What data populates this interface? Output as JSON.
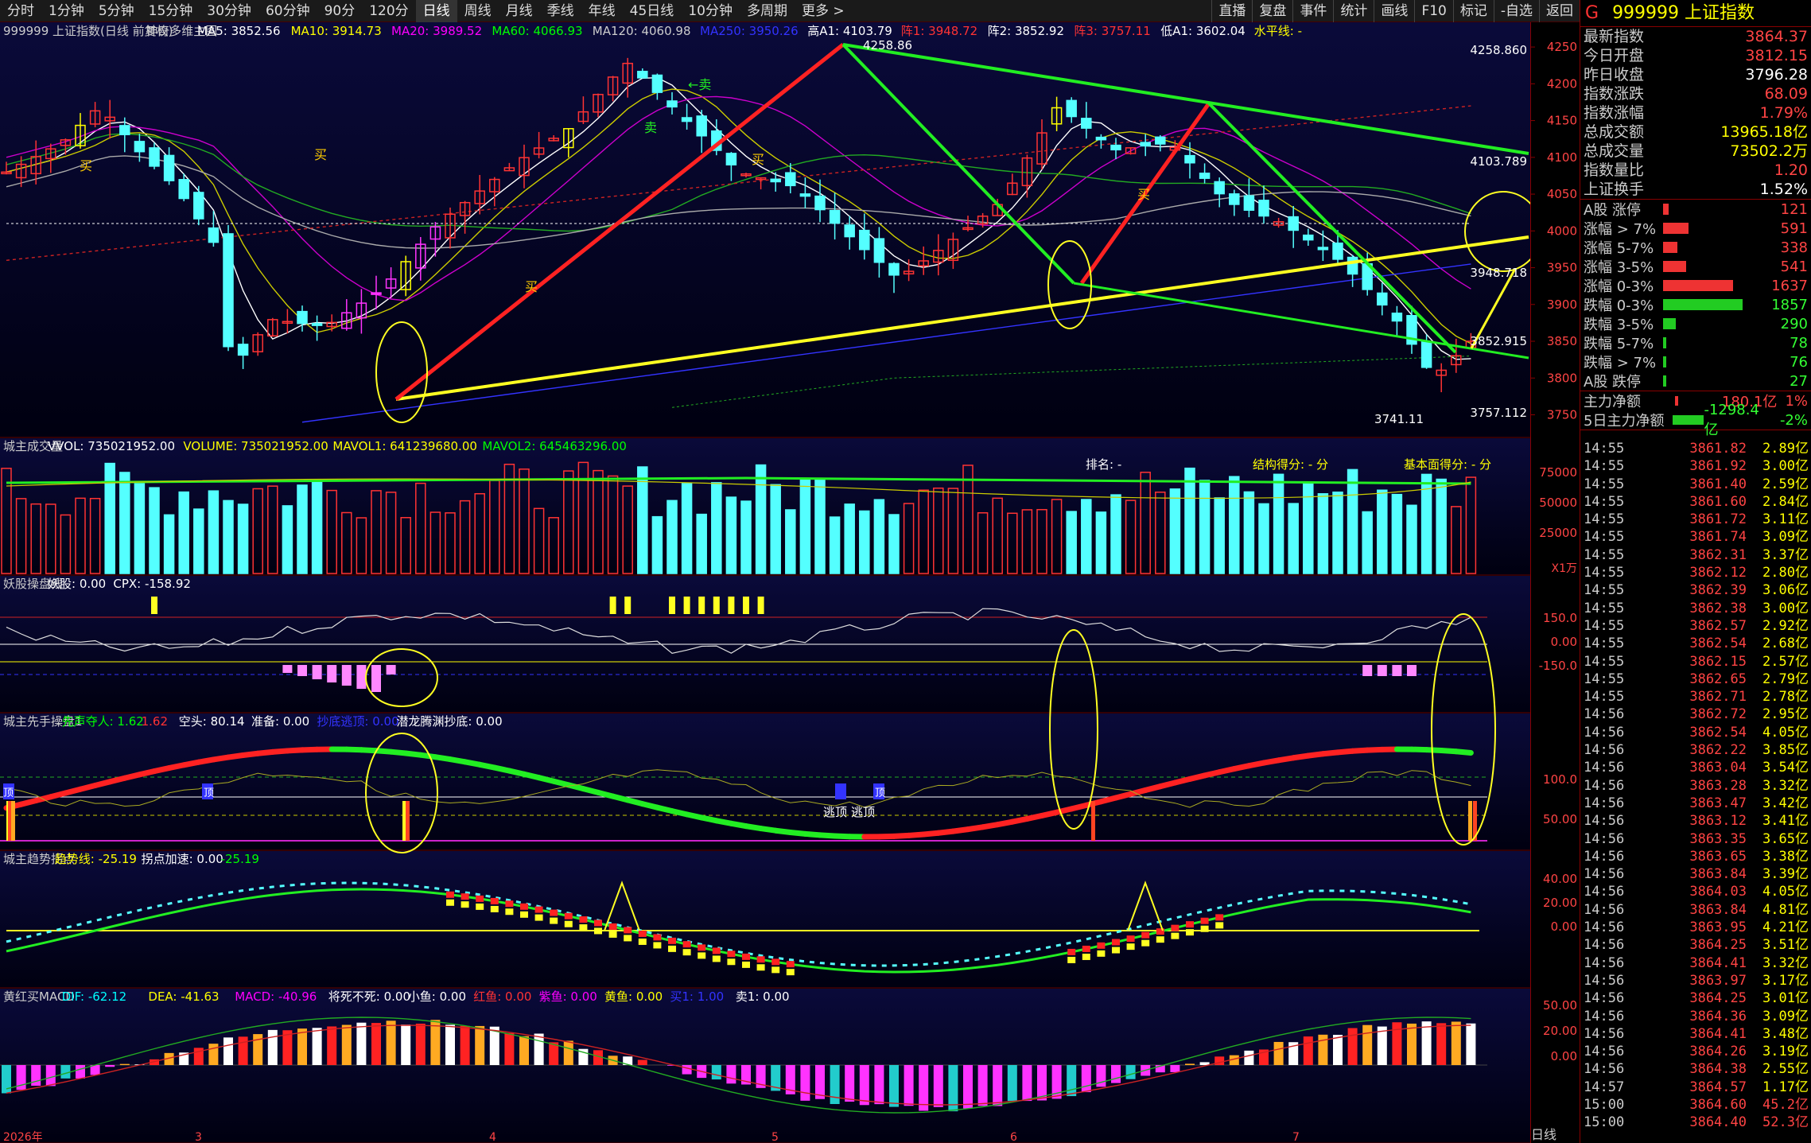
{
  "toolbar": {
    "timeframes": [
      "分时",
      "1分钟",
      "5分钟",
      "15分钟",
      "30分钟",
      "60分钟",
      "90分",
      "120分",
      "日线",
      "周线",
      "月线",
      "季线",
      "年线",
      "45日线",
      "10分钟",
      "多周期",
      "更多 >"
    ],
    "active": "日线",
    "right": [
      "直播",
      "复盘",
      "事件",
      "统计",
      "画线",
      "F10",
      "标记",
      "-自选",
      "返回"
    ]
  },
  "main": {
    "legend": [
      {
        "text": "999999 上证指数(日线 前复权)",
        "color": "#cccccc"
      },
      {
        "text": "神奇多维主图",
        "color": "#cccccc"
      },
      {
        "text": "MA5: 3852.56",
        "color": "#ffffff"
      },
      {
        "text": "MA10: 3914.73",
        "color": "#ffff00"
      },
      {
        "text": "MA20: 3989.52",
        "color": "#ff00ff"
      },
      {
        "text": "MA60: 4066.93",
        "color": "#00ff00"
      },
      {
        "text": "MA120: 4060.98",
        "color": "#cccccc"
      },
      {
        "text": "MA250: 3950.26",
        "color": "#3333ff"
      },
      {
        "text": "高A1: 4103.79",
        "color": "#ffffff"
      },
      {
        "text": "阵1: 3948.72",
        "color": "#ff3333"
      },
      {
        "text": "阵2: 3852.92",
        "color": "#ffffff"
      },
      {
        "text": "阵3: 3757.11",
        "color": "#ff3333"
      },
      {
        "text": "低A1: 3602.04",
        "color": "#ffffff"
      },
      {
        "text": "水平线: -",
        "color": "#ffff00"
      }
    ],
    "y_ticks": [
      "4250",
      "4200",
      "4150",
      "4100",
      "4050",
      "4000",
      "3950",
      "3900",
      "3850",
      "3800",
      "3750"
    ],
    "annotations": {
      "high": "4258.86",
      "r1": "4258.860",
      "r2": "4103.789",
      "r3": "3948.718",
      "r4": "3852.915",
      "r5": "3757.112",
      "low": "3741.11"
    },
    "signals": {
      "buy": "买",
      "sell": "卖",
      "arrow_sell": "←卖"
    }
  },
  "volume": {
    "legend": [
      {
        "text": "城主成交量",
        "color": "#cccccc"
      },
      {
        "text": "VVOL: 735021952.00",
        "color": "#ffffff"
      },
      {
        "text": "VOLUME: 735021952.00",
        "color": "#ffff00"
      },
      {
        "text": "MAVOL1: 641239680.00",
        "color": "#ffff00"
      },
      {
        "text": "MAVOL2: 645463296.00",
        "color": "#00ff00"
      }
    ],
    "rank": "排名: -",
    "struct": "结构得分: - 分",
    "fund": "基本面得分: - 分",
    "y_ticks": [
      "75000",
      "50000",
      "25000"
    ],
    "unit": "X1万"
  },
  "yao": {
    "legend": [
      {
        "text": "妖股操盘线",
        "color": "#cccccc"
      },
      {
        "text": "妖股: 0.00",
        "color": "#ffffff"
      },
      {
        "text": "CPX: -158.92",
        "color": "#ffffff"
      }
    ],
    "y_ticks": [
      "150.0",
      "0.00",
      "-150.0"
    ]
  },
  "xianshou": {
    "legend": [
      {
        "text": "城主先手操盘1",
        "color": "#cccccc"
      },
      {
        "text": "先声夺人: 1.62",
        "color": "#00ff00"
      },
      {
        "text": "1.62",
        "color": "#ff3333"
      },
      {
        "text": "空头: 80.14",
        "color": "#ffffff"
      },
      {
        "text": "准备: 0.00",
        "color": "#ffffff"
      },
      {
        "text": "抄底逃顶: 0.00",
        "color": "#3333ff"
      },
      {
        "text": "潜龙腾渊抄底: 0.00",
        "color": "#ffffff"
      }
    ],
    "y_ticks": [
      "100.0",
      "50.00"
    ],
    "labels": {
      "top": "顶",
      "escape": "逃顶"
    }
  },
  "trend": {
    "legend": [
      {
        "text": "城主趋势拐点",
        "color": "#cccccc"
      },
      {
        "text": "趋势线: -25.19",
        "color": "#ffff00"
      },
      {
        "text": "拐点加速: 0.00",
        "color": "#ffffff"
      },
      {
        "text": "-25.19",
        "color": "#00ff00"
      }
    ],
    "y_ticks": [
      "40.00",
      "20.00",
      "0.00"
    ]
  },
  "macd": {
    "legend": [
      {
        "text": "黄红买MACD",
        "color": "#cccccc"
      },
      {
        "text": "DIF: -62.12",
        "color": "#00ffff"
      },
      {
        "text": "DEA: -41.63",
        "color": "#ffff00"
      },
      {
        "text": "MACD: -40.96",
        "color": "#ff00ff"
      },
      {
        "text": "将死不死: 0.00",
        "color": "#ffffff"
      },
      {
        "text": "小鱼: 0.00",
        "color": "#ffffff"
      },
      {
        "text": "红鱼: 0.00",
        "color": "#ff3333"
      },
      {
        "text": "紫鱼: 0.00",
        "color": "#ff00ff"
      },
      {
        "text": "黄鱼: 0.00",
        "color": "#ffff00"
      },
      {
        "text": "买1: 1.00",
        "color": "#3333ff"
      },
      {
        "text": "卖1: 0.00",
        "color": "#ffffff"
      }
    ],
    "y_ticks": [
      "50.00",
      "20.00",
      "0.00"
    ]
  },
  "x_labels": [
    "2026年",
    "3",
    "4",
    "5",
    "6",
    "7"
  ],
  "side": {
    "code": "999999",
    "name": "上证指数",
    "badge": "G",
    "quote": [
      {
        "k": "最新指数",
        "v": "3864.37",
        "c": "r"
      },
      {
        "k": "今日开盘",
        "v": "3812.15",
        "c": "r"
      },
      {
        "k": "昨日收盘",
        "v": "3796.28",
        "c": "w"
      },
      {
        "k": "指数涨跌",
        "v": "68.09",
        "c": "r"
      },
      {
        "k": "指数涨幅",
        "v": "1.79%",
        "c": "r"
      },
      {
        "k": "总成交额",
        "v": "13965.18亿",
        "c": "y"
      },
      {
        "k": "总成交量",
        "v": "73502.2万",
        "c": "y"
      },
      {
        "k": "指数量比",
        "v": "1.20",
        "c": "r"
      },
      {
        "k": "上证换手",
        "v": "1.52%",
        "c": "w"
      }
    ],
    "breadth": [
      {
        "k": "A股 涨停",
        "n": 121,
        "c": "#ee3333"
      },
      {
        "k": "涨幅 > 7%",
        "n": 591,
        "c": "#ee3333"
      },
      {
        "k": "涨幅 5-7%",
        "n": 338,
        "c": "#ee3333"
      },
      {
        "k": "涨幅 3-5%",
        "n": 541,
        "c": "#ee3333"
      },
      {
        "k": "涨幅 0-3%",
        "n": 1637,
        "c": "#ee3333"
      },
      {
        "k": "跌幅 0-3%",
        "n": 1857,
        "c": "#22cc22"
      },
      {
        "k": "跌幅 3-5%",
        "n": 290,
        "c": "#22cc22"
      },
      {
        "k": "跌幅 5-7%",
        "n": 78,
        "c": "#22cc22"
      },
      {
        "k": "跌幅 > 7%",
        "n": 76,
        "c": "#22cc22"
      },
      {
        "k": "A股 跌停",
        "n": 27,
        "c": "#22cc22"
      }
    ],
    "flow": [
      {
        "k": "主力净额",
        "v": "180.1亿",
        "p": "1%"
      },
      {
        "k": "5日主力净额",
        "v": "-1298.4亿",
        "p": "-2%"
      }
    ],
    "ticks": [
      [
        "14:55",
        "3861.82",
        "2.89亿"
      ],
      [
        "14:55",
        "3861.92",
        "3.00亿"
      ],
      [
        "14:55",
        "3861.40",
        "2.59亿"
      ],
      [
        "14:55",
        "3861.60",
        "2.84亿"
      ],
      [
        "14:55",
        "3861.72",
        "3.11亿"
      ],
      [
        "14:55",
        "3861.74",
        "3.09亿"
      ],
      [
        "14:55",
        "3862.31",
        "3.37亿"
      ],
      [
        "14:55",
        "3862.12",
        "2.80亿"
      ],
      [
        "14:55",
        "3862.39",
        "3.06亿"
      ],
      [
        "14:55",
        "3862.38",
        "3.00亿"
      ],
      [
        "14:55",
        "3862.57",
        "2.92亿"
      ],
      [
        "14:55",
        "3862.54",
        "2.68亿"
      ],
      [
        "14:55",
        "3862.15",
        "2.57亿"
      ],
      [
        "14:55",
        "3862.65",
        "2.79亿"
      ],
      [
        "14:55",
        "3862.71",
        "2.78亿"
      ],
      [
        "14:56",
        "3862.72",
        "2.95亿"
      ],
      [
        "14:56",
        "3862.54",
        "4.05亿"
      ],
      [
        "14:56",
        "3862.22",
        "3.85亿"
      ],
      [
        "14:56",
        "3863.04",
        "3.54亿"
      ],
      [
        "14:56",
        "3863.28",
        "3.32亿"
      ],
      [
        "14:56",
        "3863.47",
        "3.42亿"
      ],
      [
        "14:56",
        "3863.12",
        "3.41亿"
      ],
      [
        "14:56",
        "3863.35",
        "3.65亿"
      ],
      [
        "14:56",
        "3863.65",
        "3.38亿"
      ],
      [
        "14:56",
        "3863.84",
        "3.39亿"
      ],
      [
        "14:56",
        "3864.03",
        "4.05亿"
      ],
      [
        "14:56",
        "3863.84",
        "4.81亿"
      ],
      [
        "14:56",
        "3863.95",
        "4.21亿"
      ],
      [
        "14:56",
        "3864.25",
        "3.51亿"
      ],
      [
        "14:56",
        "3864.41",
        "3.32亿"
      ],
      [
        "14:56",
        "3863.97",
        "3.17亿"
      ],
      [
        "14:56",
        "3864.25",
        "3.01亿"
      ],
      [
        "14:56",
        "3864.36",
        "3.09亿"
      ],
      [
        "14:56",
        "3864.41",
        "3.48亿"
      ],
      [
        "14:56",
        "3864.26",
        "3.19亿"
      ],
      [
        "14:56",
        "3864.38",
        "2.55亿"
      ],
      [
        "14:57",
        "3864.57",
        "1.17亿"
      ],
      [
        "15:00",
        "3864.60",
        "45.2亿"
      ],
      [
        "15:00",
        "3864.40",
        "52.3亿"
      ]
    ],
    "footer": "日线"
  },
  "colors": {
    "up": "#ff3333",
    "down": "#54ffff",
    "magenta": "#ff33ff",
    "yellow": "#ffff00",
    "green": "#33ff33"
  }
}
